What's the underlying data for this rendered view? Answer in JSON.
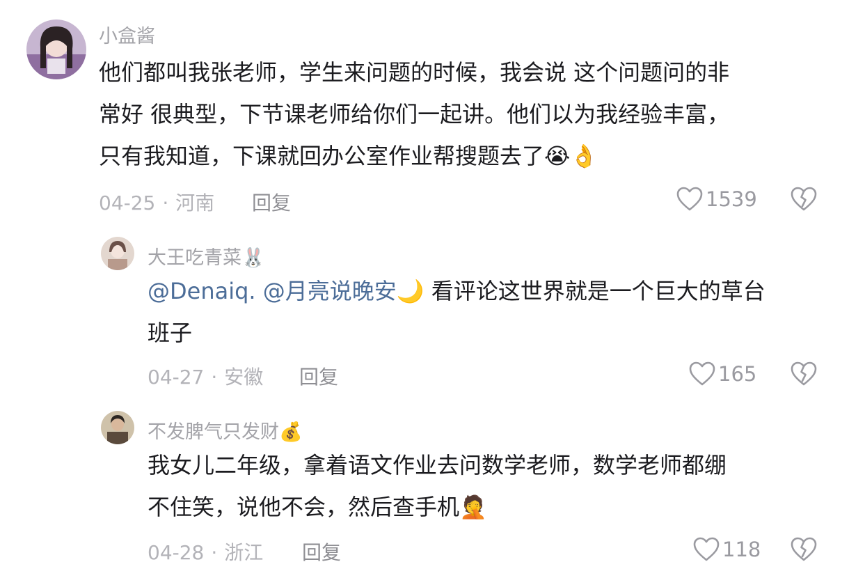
{
  "comments": [
    {
      "username": "小盒酱",
      "lines": [
        "他们都叫我张老师，学生来问题的时候，我会说 这个问题问的非",
        "常好 很典型，下节课老师给你们一起讲。他们以为我经验丰富，",
        "只有我知道，下课就回办公室作业帮搜题去了"
      ],
      "line3_emojis": "😭👌",
      "date": "04-25",
      "location": "河南",
      "reply_label": "回复",
      "likes": "1539"
    },
    {
      "username": "大王吃青菜",
      "username_emoji": "🐰",
      "mention": "@Denaiq. @月亮说晚安",
      "mention_emoji": "🌙",
      "line1_rest": " 看评论这世界就是一个巨大的草台",
      "line2": "班子",
      "date": "04-27",
      "location": "安徽",
      "reply_label": "回复",
      "likes": "165"
    },
    {
      "username": "不发脾气只发财",
      "username_emoji": "💰",
      "lines": [
        "我女儿二年级，拿着语文作业去问数学老师，数学老师都绷",
        "不住笑，说他不会，然后查手机"
      ],
      "line2_emoji": "🤦",
      "date": "04-28",
      "location": "浙江",
      "reply_label": "回复",
      "likes": "118"
    }
  ],
  "separator": "·",
  "icons": {
    "like": "heart-outline-icon",
    "dislike": "broken-heart-icon"
  },
  "colors": {
    "mention": "#4c6d98",
    "meta": "#b3b3b8",
    "username": "#a3a3a8"
  }
}
